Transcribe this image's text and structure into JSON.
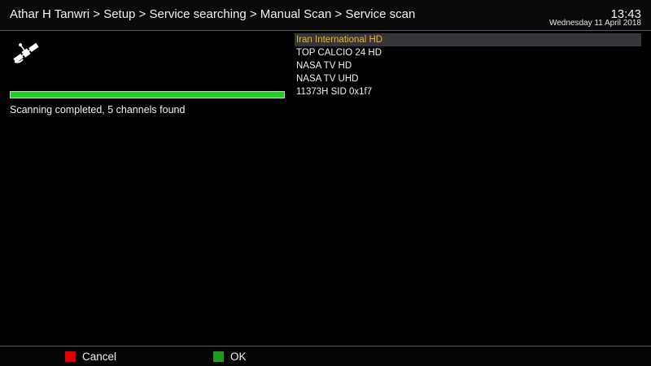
{
  "header": {
    "breadcrumb": "Athar H Tanwri > Setup > Service searching > Manual Scan > Service scan",
    "time": "13:43",
    "date": "Wednesday 11 April 2018"
  },
  "scan": {
    "icon": "satellite-icon",
    "progress_percent": 100,
    "status": "Scanning completed, 5 channels found"
  },
  "channels": [
    "Iran International HD",
    "TOP CALCIO 24 HD",
    "NASA TV HD",
    "NASA TV UHD",
    "11373H SID 0x1f7"
  ],
  "footer": {
    "cancel_label": "Cancel",
    "ok_label": "OK",
    "red_key_color": "#e00000",
    "green_key_color": "#1e9a1e"
  },
  "colors": {
    "progress_fill": "#1fce1f",
    "selected_text": "#f0b428"
  }
}
